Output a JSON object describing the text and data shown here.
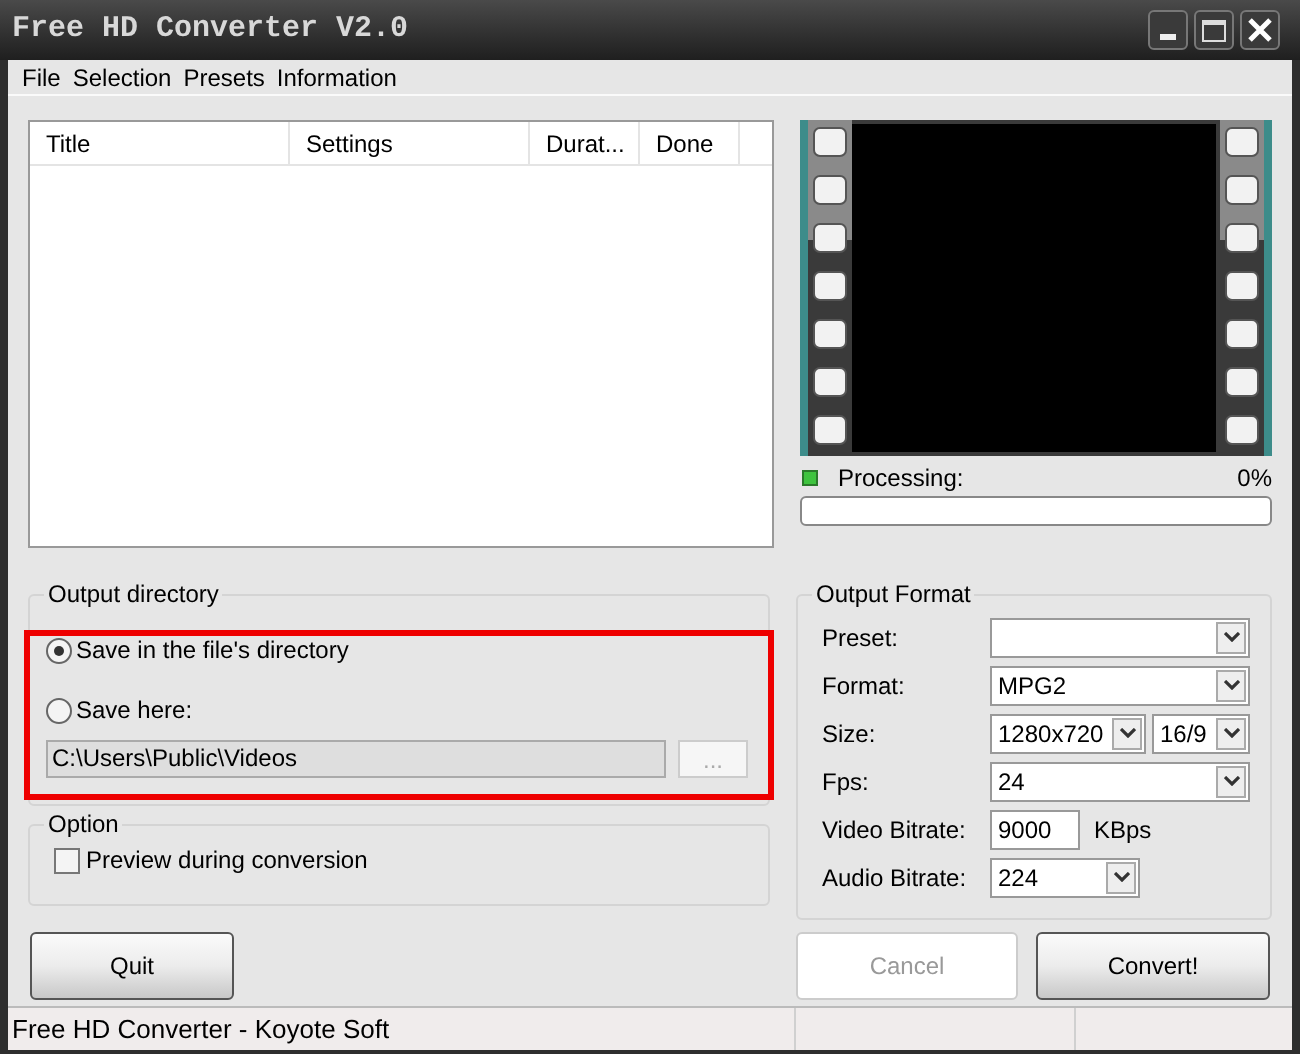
{
  "window": {
    "title": "Free HD Converter V2.0"
  },
  "menu": [
    {
      "label": "File"
    },
    {
      "label": "Selection"
    },
    {
      "label": "Presets"
    },
    {
      "label": "Information"
    }
  ],
  "file_list": {
    "columns": [
      "Title",
      "Settings",
      "Durat...",
      "Done"
    ]
  },
  "preview": {
    "processing_label": "Processing:",
    "percent": "0%",
    "level": 0
  },
  "output_directory": {
    "title": "Output directory",
    "options": [
      {
        "label": "Save in the file's directory",
        "selected": true
      },
      {
        "label": "Save here:",
        "selected": false
      }
    ],
    "path": "C:\\Users\\Public\\Videos",
    "browse_button": {
      "label": "...",
      "disabled": true
    }
  },
  "option": {
    "title": "Option",
    "checkbox": {
      "label": "Preview during conversion",
      "checked": false
    }
  },
  "output_format": {
    "title": "Output Format",
    "fields": [
      {
        "label": "Preset:",
        "kind": "select"
      },
      {
        "label": "Format:",
        "kind": "select",
        "value": "MPG2"
      },
      {
        "label": "Size:",
        "kind": "select_pair",
        "values": [
          "1280x720",
          "16/9"
        ]
      },
      {
        "label": "Fps:",
        "kind": "select",
        "value": "24"
      },
      {
        "label": "Video Bitrate:",
        "kind": "input",
        "value": "9000",
        "unit": "KBps"
      },
      {
        "label": "Audio Bitrate:",
        "kind": "short_select",
        "value": "224"
      }
    ]
  },
  "buttons_left": [
    {
      "label": "Quit",
      "disabled": false
    }
  ],
  "buttons_right": [
    {
      "label": "Cancel",
      "disabled": true
    },
    {
      "label": "Convert!",
      "disabled": false
    }
  ],
  "status_bar": {
    "text": "Free HD Converter - Koyote Soft"
  }
}
